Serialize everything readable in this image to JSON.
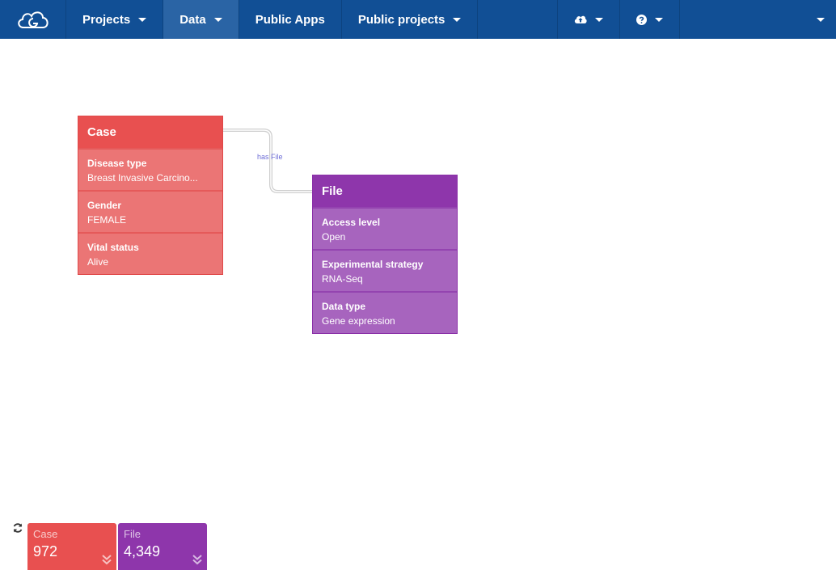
{
  "nav": {
    "items": [
      {
        "label": "Projects",
        "caret": true,
        "active": false
      },
      {
        "label": "Data",
        "caret": true,
        "active": true
      },
      {
        "label": "Public Apps",
        "caret": false,
        "active": false
      },
      {
        "label": "Public projects",
        "caret": true,
        "active": false
      }
    ],
    "icons": [
      "cloud-upload-icon",
      "question-circle-icon"
    ]
  },
  "graph": {
    "case": {
      "title": "Case",
      "fields": [
        {
          "label": "Disease type",
          "value": "Breast Invasive Carcino..."
        },
        {
          "label": "Gender",
          "value": "FEMALE"
        },
        {
          "label": "Vital status",
          "value": "Alive"
        }
      ]
    },
    "file": {
      "title": "File",
      "fields": [
        {
          "label": "Access level",
          "value": "Open"
        },
        {
          "label": "Experimental strategy",
          "value": "RNA-Seq"
        },
        {
          "label": "Data type",
          "value": "Gene expression"
        }
      ]
    },
    "edge_label": "has File"
  },
  "counts": {
    "case": {
      "label": "Case",
      "value": "972"
    },
    "file": {
      "label": "File",
      "value": "4,349"
    }
  },
  "colors": {
    "navbar": "#114f95",
    "case": "#e85050",
    "file": "#8e36ab"
  }
}
